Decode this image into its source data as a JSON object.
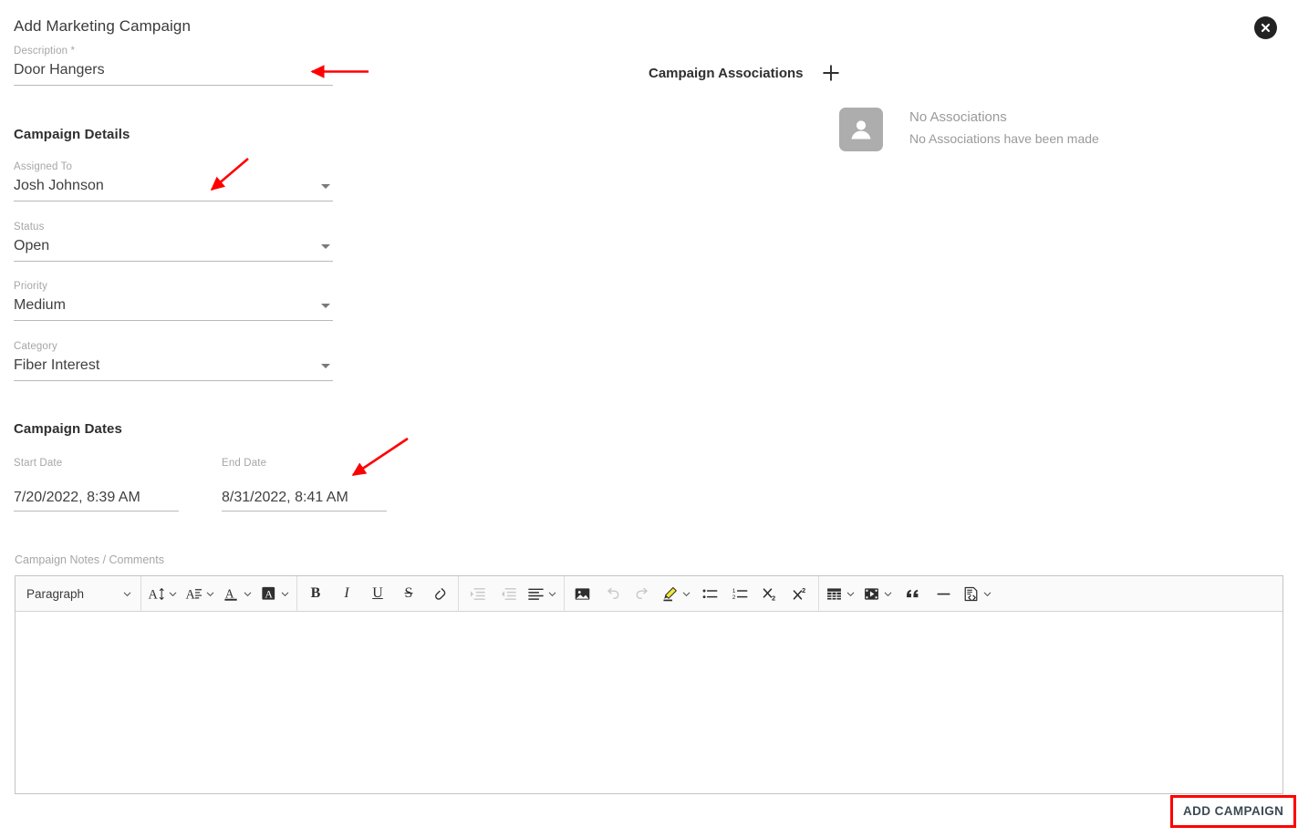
{
  "dialog": {
    "title": "Add Marketing Campaign",
    "close_icon": "close-circle-icon"
  },
  "description_field": {
    "label": "Description *",
    "value": "Door Hangers"
  },
  "campaign_details": {
    "heading": "Campaign Details",
    "fields": [
      {
        "label": "Assigned To",
        "value": "Josh Johnson",
        "icon": "chevron-down-icon"
      },
      {
        "label": "Status",
        "value": "Open",
        "icon": "chevron-down-icon"
      },
      {
        "label": "Priority",
        "value": "Medium",
        "icon": "chevron-down-icon"
      },
      {
        "label": "Category",
        "value": "Fiber Interest",
        "icon": "chevron-down-icon"
      }
    ]
  },
  "campaign_dates": {
    "heading": "Campaign Dates",
    "start": {
      "label": "Start Date",
      "value": "7/20/2022, 8:39 AM"
    },
    "end": {
      "label": "End Date",
      "value": "8/31/2022, 8:41 AM"
    }
  },
  "associations": {
    "title": "Campaign Associations",
    "add_icon": "plus-icon",
    "avatar_icon": "person-placeholder-icon",
    "empty_title": "No Associations",
    "empty_subtitle": "No Associations have been made"
  },
  "notes": {
    "label": "Campaign Notes / Comments",
    "body_value": ""
  },
  "editor_toolbar": {
    "paragraph_style": "Paragraph",
    "buttons": [
      {
        "name": "font-size-icon",
        "label": "Font Size",
        "disabled": false
      },
      {
        "name": "line-height-icon",
        "label": "Line Height",
        "disabled": false
      },
      {
        "name": "font-color-icon",
        "label": "Font Color",
        "disabled": false
      },
      {
        "name": "background-color-icon",
        "label": "Background Color",
        "disabled": false
      },
      {
        "name": "bold-icon",
        "label": "B",
        "disabled": false
      },
      {
        "name": "italic-icon",
        "label": "I",
        "disabled": false
      },
      {
        "name": "underline-icon",
        "label": "U",
        "disabled": false
      },
      {
        "name": "strikethrough-icon",
        "label": "S",
        "disabled": false
      },
      {
        "name": "link-icon",
        "label": "Link",
        "disabled": false
      },
      {
        "name": "indent-increase-icon",
        "label": "Increase Indent",
        "disabled": true
      },
      {
        "name": "indent-decrease-icon",
        "label": "Decrease Indent",
        "disabled": true
      },
      {
        "name": "align-icon",
        "label": "Align",
        "disabled": false
      },
      {
        "name": "image-icon",
        "label": "Image",
        "disabled": false
      },
      {
        "name": "undo-icon",
        "label": "Undo",
        "disabled": true
      },
      {
        "name": "redo-icon",
        "label": "Redo",
        "disabled": true
      },
      {
        "name": "highlight-icon",
        "label": "Highlight",
        "disabled": false
      },
      {
        "name": "bulleted-list-icon",
        "label": "Bulleted List",
        "disabled": false
      },
      {
        "name": "numbered-list-icon",
        "label": "Numbered List",
        "disabled": false
      },
      {
        "name": "subscript-icon",
        "label": "Subscript",
        "disabled": false
      },
      {
        "name": "superscript-icon",
        "label": "Superscript",
        "disabled": false
      },
      {
        "name": "table-icon",
        "label": "Table",
        "disabled": false
      },
      {
        "name": "video-icon",
        "label": "Video",
        "disabled": false
      },
      {
        "name": "blockquote-icon",
        "label": "Blockquote",
        "disabled": false
      },
      {
        "name": "horizontal-rule-icon",
        "label": "Horizontal Rule",
        "disabled": false
      },
      {
        "name": "source-code-icon",
        "label": "Source Code",
        "disabled": false
      }
    ]
  },
  "footer": {
    "add_campaign_label": "ADD CAMPAIGN",
    "highlight_color": "#ff0000"
  },
  "annotations": {
    "arrow_color": "#ff0000",
    "arrows": [
      {
        "name": "arrow-to-description",
        "target": "Description field"
      },
      {
        "name": "arrow-to-assigned-to",
        "target": "Assigned To field"
      },
      {
        "name": "arrow-to-end-date",
        "target": "End Date field"
      }
    ]
  }
}
